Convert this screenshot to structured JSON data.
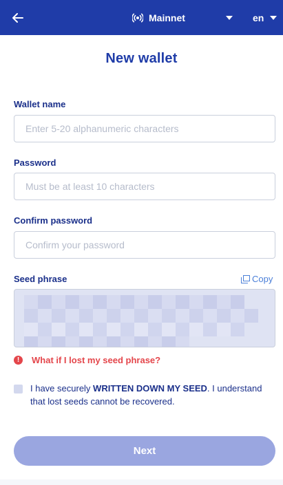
{
  "header": {
    "network_label": "Mainnet",
    "language": "en",
    "icons": {
      "back": "arrow-left-icon",
      "network": "broadcast-icon",
      "caret": "chevron-down-icon"
    }
  },
  "page": {
    "title": "New wallet"
  },
  "form": {
    "wallet_name": {
      "label": "Wallet name",
      "value": "",
      "placeholder": "Enter 5-20 alphanumeric characters"
    },
    "password": {
      "label": "Password",
      "value": "",
      "placeholder": "Must be at least 10 characters"
    },
    "confirm_password": {
      "label": "Confirm password",
      "value": "",
      "placeholder": "Confirm your password"
    },
    "seed": {
      "label": "Seed phrase",
      "copy_label": "Copy",
      "copy_icon": "copy-icon"
    }
  },
  "warning": {
    "text": "What if I lost my seed phrase?",
    "icon": "alert-icon"
  },
  "acknowledgement": {
    "checked": false,
    "text_before": "I have securely ",
    "text_emphasis": "WRITTEN DOWN MY SEED",
    "text_after": ". I understand that lost seeds cannot be recovered."
  },
  "actions": {
    "next_label": "Next"
  },
  "colors": {
    "primary": "#1f3ca8",
    "label": "#1a2f8a",
    "link": "#4a7fd8",
    "danger": "#e4464b",
    "button_disabled": "#9aa6e0",
    "seed_background": "#dfe3f3"
  }
}
